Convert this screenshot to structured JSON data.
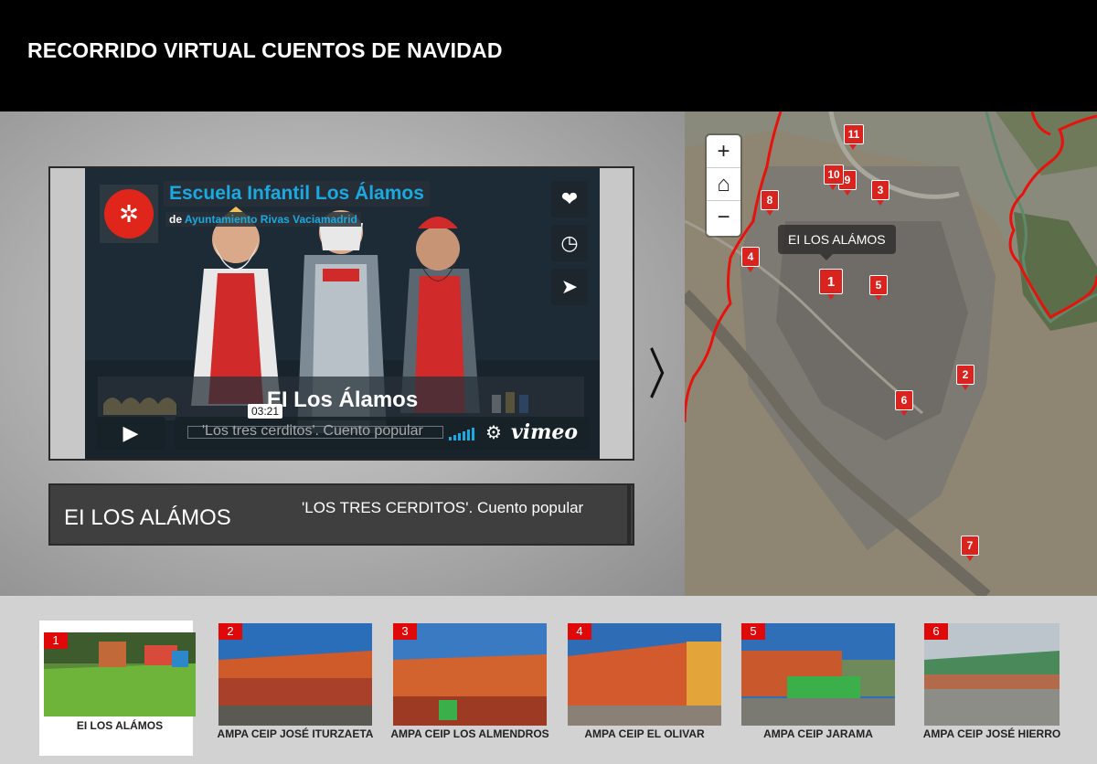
{
  "header": {
    "title": "RECORRIDO VIRTUAL CUENTOS DE NAVIDAD"
  },
  "video": {
    "channel_title": "Escuela Infantil Los Álamos",
    "by_prefix": "de",
    "by_author": "Ayuntamiento Rivas Vaciamadrid",
    "scene_caption": "EI Los Álamos",
    "bar_title": "'Los tres cerditos'. Cuento popular",
    "time": "03:21",
    "brand": "vimeo",
    "side_buttons": [
      "like-icon",
      "watch-later-icon",
      "share-icon"
    ],
    "play_icon": "▶"
  },
  "info": {
    "name": "EI LOS ALÁMOS",
    "description": "'LOS TRES CERDITOS'. Cuento popular"
  },
  "navigation": {
    "next_icon": "chevron-right-icon"
  },
  "map": {
    "zoom": {
      "in": "+",
      "home": "home-icon",
      "out": "−"
    },
    "tooltip": "EI LOS ALÁMOS",
    "markers": [
      "1",
      "2",
      "3",
      "4",
      "5",
      "6",
      "7",
      "8",
      "9",
      "10",
      "11"
    ]
  },
  "thumbnails": [
    {
      "num": "1",
      "label": "EI LOS ALÁMOS",
      "active": true
    },
    {
      "num": "2",
      "label": "AMPA CEIP JOSÉ ITURZAETA",
      "active": false
    },
    {
      "num": "3",
      "label": "AMPA CEIP LOS ALMENDROS",
      "active": false
    },
    {
      "num": "4",
      "label": "AMPA CEIP EL OLIVAR",
      "active": false
    },
    {
      "num": "5",
      "label": "AMPA CEIP JARAMA",
      "active": false
    },
    {
      "num": "6",
      "label": "AMPA CEIP JOSÉ HIERRO",
      "active": false
    }
  ],
  "colors": {
    "accent_red": "#e0090a",
    "vimeo_blue": "#1aa9e0",
    "route_red": "#e8120c"
  }
}
